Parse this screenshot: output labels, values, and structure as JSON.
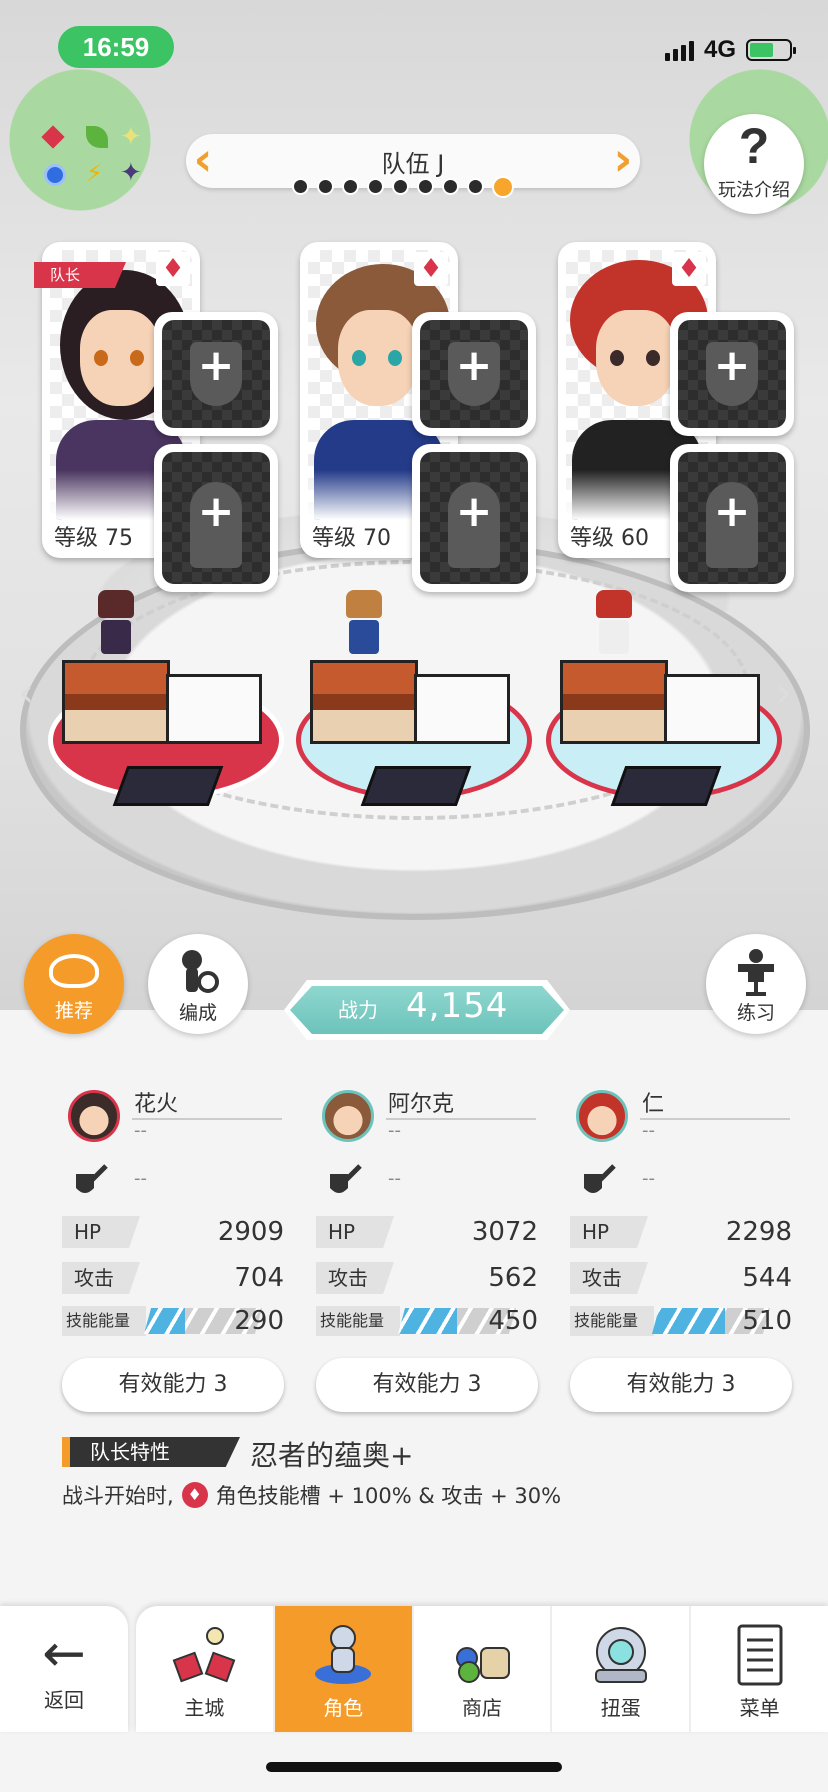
{
  "status_bar": {
    "time": "16:59",
    "network": "4G"
  },
  "header": {
    "team_title": "队伍 J",
    "team_count": 9,
    "active_team_index": 8,
    "help_label": "玩法介绍"
  },
  "characters": [
    {
      "level_label": "等级 75",
      "leader_tag": "队长",
      "suit": "♦"
    },
    {
      "level_label": "等级 70",
      "suit": "♦"
    },
    {
      "level_label": "等级 60",
      "suit": "♦"
    }
  ],
  "actions": {
    "recommend_label": "推荐",
    "formation_label": "编成",
    "training_label": "练习",
    "power_label": "战力",
    "power_value": "4,154"
  },
  "stats": [
    {
      "name": "花火",
      "sub": "--",
      "gear": "--",
      "hp_label": "HP",
      "hp": "2909",
      "atk_label": "攻击",
      "atk": "704",
      "energy_label": "技能能量",
      "energy": "290",
      "energy_fill": 0.35,
      "ability": "有效能力 3"
    },
    {
      "name": "阿尔克",
      "sub": "--",
      "gear": "--",
      "hp_label": "HP",
      "hp": "3072",
      "atk_label": "攻击",
      "atk": "562",
      "energy_label": "技能能量",
      "energy": "450",
      "energy_fill": 0.5,
      "ability": "有效能力 3"
    },
    {
      "name": "仁",
      "sub": "--",
      "gear": "--",
      "hp_label": "HP",
      "hp": "2298",
      "atk_label": "攻击",
      "atk": "544",
      "energy_label": "技能能量",
      "energy": "510",
      "energy_fill": 0.62,
      "ability": "有效能力 3"
    }
  ],
  "leader_trait": {
    "tag": "队长特性",
    "name": "忍者的蕴奥+",
    "desc_prefix": "战斗开始时,",
    "desc_suffix": "角色技能槽 + 100% & 攻击 + 30%"
  },
  "nav": {
    "back_label": "返回",
    "tabs": [
      {
        "label": "主城",
        "icon": "castle-icon"
      },
      {
        "label": "角色",
        "icon": "character-icon",
        "active": true
      },
      {
        "label": "商店",
        "icon": "shop-icon"
      },
      {
        "label": "扭蛋",
        "icon": "gacha-icon"
      },
      {
        "label": "菜单",
        "icon": "menu-icon"
      }
    ]
  },
  "colors": {
    "accent": "#f49b2a",
    "fire": "#d8354a",
    "power": "#6cc3bb",
    "energy": "#4eb3e0"
  }
}
